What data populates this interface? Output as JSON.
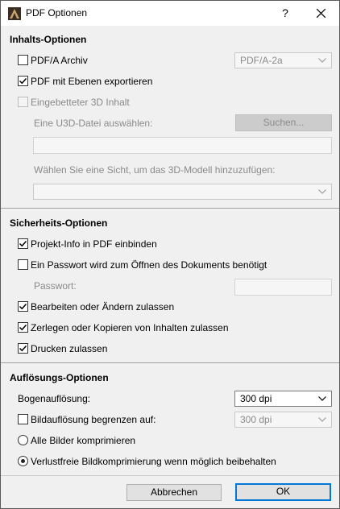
{
  "window": {
    "title": "PDF Optionen",
    "help_label": "?"
  },
  "content": {
    "section_title": "Inhalts-Optionen",
    "pdfa": {
      "label": "PDF/A Archiv",
      "checked": false,
      "select_value": "PDF/A-2a"
    },
    "layers": {
      "label": "PDF mit Ebenen exportieren",
      "checked": true
    },
    "embedded3d": {
      "label": "Eingebetteter 3D Inhalt",
      "checked": false,
      "disabled": true
    },
    "u3d_label": "Eine U3D-Datei auswählen:",
    "u3d_button": "Suchen...",
    "u3d_path": "",
    "view_label": "Wählen Sie eine Sicht, um das 3D-Modell hinzuzufügen:",
    "view_value": ""
  },
  "security": {
    "section_title": "Sicherheits-Optionen",
    "project_info": {
      "label": "Projekt-Info in PDF einbinden",
      "checked": true
    },
    "password_required": {
      "label": "Ein Passwort wird zum Öffnen des Dokuments benötigt",
      "checked": false
    },
    "password_label": "Passwort:",
    "password_value": "",
    "allow_edit": {
      "label": "Bearbeiten oder Ändern zulassen",
      "checked": true
    },
    "allow_copy": {
      "label": "Zerlegen oder Kopieren von Inhalten zulassen",
      "checked": true
    },
    "allow_print": {
      "label": "Drucken zulassen",
      "checked": true
    }
  },
  "resolution": {
    "section_title": "Auflösungs-Optionen",
    "arc_label": "Bogenauflösung:",
    "arc_value": "300 dpi",
    "limit_image": {
      "label": "Bildauflösung begrenzen auf:",
      "checked": false,
      "value": "300 dpi"
    },
    "compress_all": {
      "label": "Alle Bilder komprimieren",
      "selected": false
    },
    "lossless": {
      "label": "Verlustfreie Bildkomprimierung wenn möglich beibehalten",
      "selected": true
    }
  },
  "footer": {
    "cancel_label": "Abbrechen",
    "ok_label": "OK"
  }
}
